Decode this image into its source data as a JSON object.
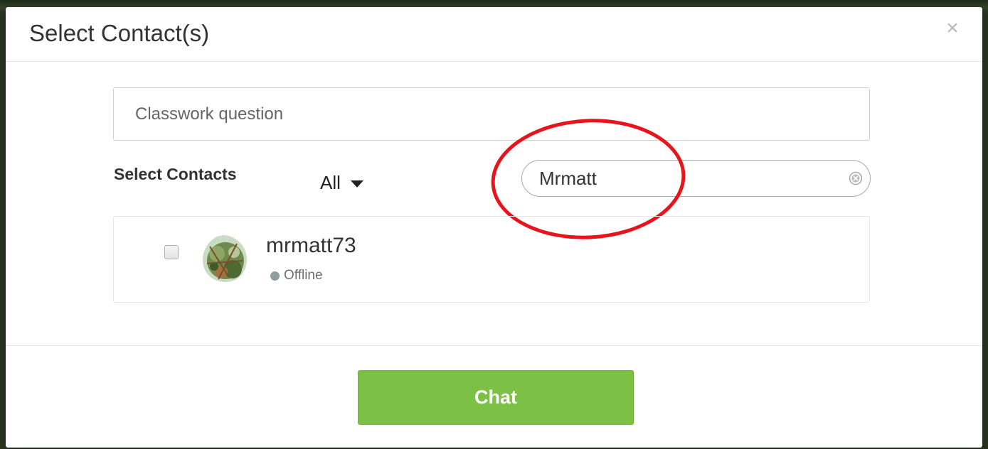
{
  "modal": {
    "title": "Select Contact(s)",
    "close_glyph": "×"
  },
  "subject": {
    "placeholder": "Classwork question"
  },
  "contacts_filter": {
    "label": "Select Contacts",
    "selected_value": "All",
    "caret_icon": "caret-down-icon"
  },
  "search": {
    "value": "Mrmatt",
    "clear_icon": "clear-circle-icon"
  },
  "annotation": {
    "shape": "ellipse",
    "color": "#e8141c"
  },
  "contacts": [
    {
      "name": "mrmatt73",
      "status": "Offline",
      "checked": false,
      "status_color": "#8f9ea0"
    }
  ],
  "footer": {
    "chat_label": "Chat"
  },
  "colors": {
    "primary_button": "#7cc146",
    "text": "#333333"
  }
}
